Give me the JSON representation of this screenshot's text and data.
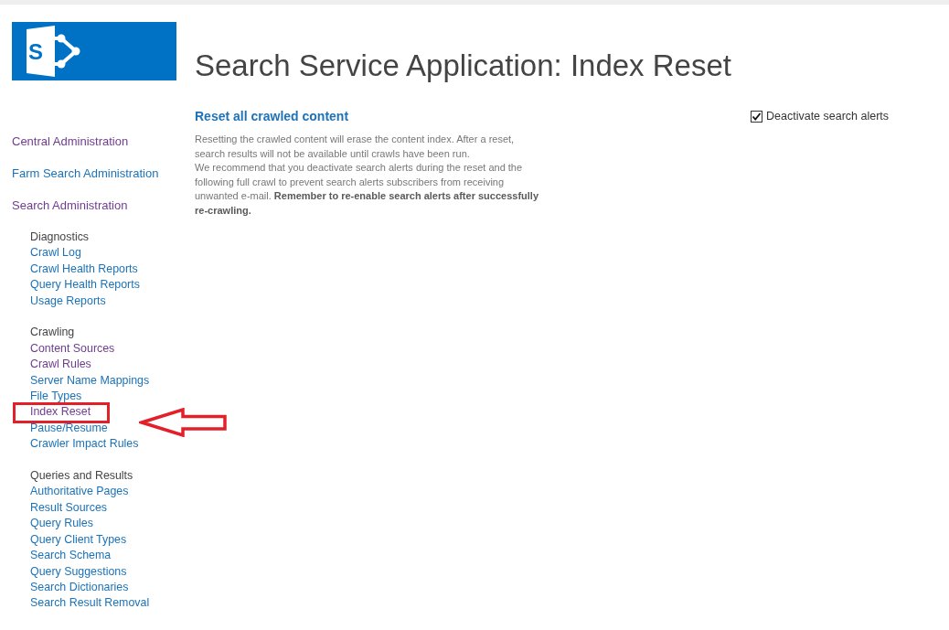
{
  "logo": {
    "letter": "S"
  },
  "page_title": "Search Service Application: Index Reset",
  "nav": {
    "top_links": [
      {
        "label": "Central Administration",
        "visited": true
      },
      {
        "label": "Farm Search Administration",
        "visited": false
      },
      {
        "label": "Search Administration",
        "visited": true
      }
    ],
    "groups": [
      {
        "heading": "Diagnostics",
        "links": [
          {
            "label": "Crawl Log",
            "visited": false,
            "highlighted": false
          },
          {
            "label": "Crawl Health Reports",
            "visited": false,
            "highlighted": false
          },
          {
            "label": "Query Health Reports",
            "visited": false,
            "highlighted": false
          },
          {
            "label": "Usage Reports",
            "visited": false,
            "highlighted": false
          }
        ]
      },
      {
        "heading": "Crawling",
        "links": [
          {
            "label": "Content Sources",
            "visited": true,
            "highlighted": false
          },
          {
            "label": "Crawl Rules",
            "visited": true,
            "highlighted": false
          },
          {
            "label": "Server Name Mappings",
            "visited": false,
            "highlighted": false
          },
          {
            "label": "File Types",
            "visited": false,
            "highlighted": false
          },
          {
            "label": "Index Reset",
            "visited": true,
            "highlighted": true
          },
          {
            "label": "Pause/Resume",
            "visited": false,
            "highlighted": false
          },
          {
            "label": "Crawler Impact Rules",
            "visited": false,
            "highlighted": false
          }
        ]
      },
      {
        "heading": "Queries and Results",
        "links": [
          {
            "label": "Authoritative Pages",
            "visited": false,
            "highlighted": false
          },
          {
            "label": "Result Sources",
            "visited": false,
            "highlighted": false
          },
          {
            "label": "Query Rules",
            "visited": false,
            "highlighted": false
          },
          {
            "label": "Query Client Types",
            "visited": false,
            "highlighted": false
          },
          {
            "label": "Search Schema",
            "visited": false,
            "highlighted": false
          },
          {
            "label": "Query Suggestions",
            "visited": false,
            "highlighted": false
          },
          {
            "label": "Search Dictionaries",
            "visited": false,
            "highlighted": false
          },
          {
            "label": "Search Result Removal",
            "visited": false,
            "highlighted": false
          }
        ]
      }
    ]
  },
  "section": {
    "heading": "Reset all crawled content",
    "paragraphs": [
      "Resetting the crawled content will erase the content index. After a reset, search results will not be available until crawls have been run.",
      "We recommend that you deactivate search alerts during the reset and the following full crawl to prevent search alerts subscribers from receiving unwanted e-mail. **Remember to re-enable search alerts after successfully re-crawling.**"
    ]
  },
  "options": [
    {
      "label": "Deactivate search alerts",
      "checked": true
    }
  ]
}
